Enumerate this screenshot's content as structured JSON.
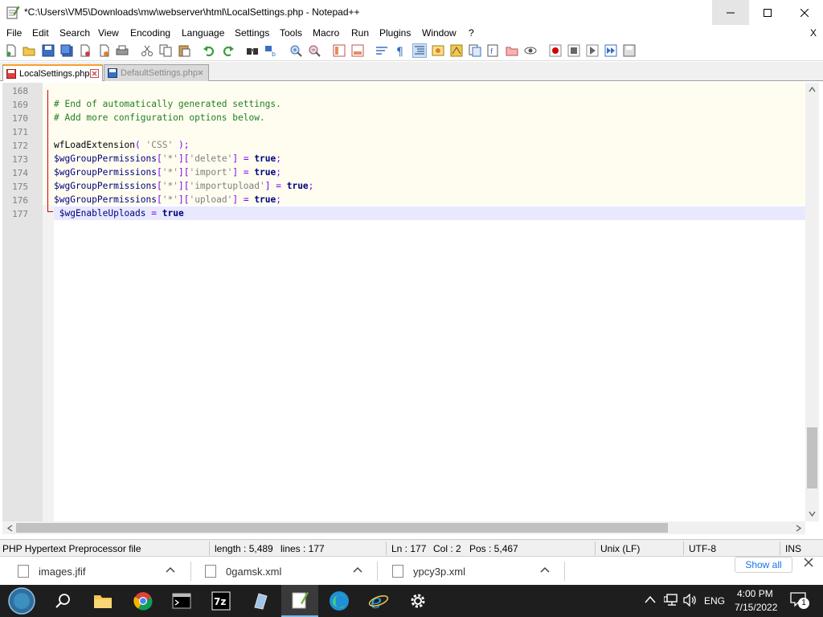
{
  "window": {
    "title": "*C:\\Users\\VM5\\Downloads\\mw\\webserver\\html\\LocalSettings.php - Notepad++"
  },
  "menu": [
    "File",
    "Edit",
    "Search",
    "View",
    "Encoding",
    "Language",
    "Settings",
    "Tools",
    "Macro",
    "Run",
    "Plugins",
    "Window",
    "?"
  ],
  "menu_close": "X",
  "tabs": [
    {
      "label": "LocalSettings.php",
      "active": true
    },
    {
      "label": "DefaultSettings.php",
      "active": false
    }
  ],
  "lines": [
    {
      "num": "168"
    },
    {
      "num": "169"
    },
    {
      "num": "170"
    },
    {
      "num": "171"
    },
    {
      "num": "172"
    },
    {
      "num": "173"
    },
    {
      "num": "174"
    },
    {
      "num": "175"
    },
    {
      "num": "176"
    },
    {
      "num": "177"
    }
  ],
  "code": {
    "l169": "# End of automatically generated settings.",
    "l170": "# Add more configuration options below.",
    "l172_fn": "wfLoadExtension",
    "l172_open": "( ",
    "l172_str": "'CSS'",
    "l172_close": " );",
    "var_perm": "$wgGroupPermissions",
    "bracket_open": "[",
    "bracket_close": "]",
    "star": "'*'",
    "delete": "'delete'",
    "import": "'import'",
    "importupload": "'importupload'",
    "upload": "'upload'",
    "eq": " = ",
    "true": "true",
    "semi": ";",
    "l177_var": " $wgEnableUploads",
    "l177_eq": " = ",
    "l177_val": "true"
  },
  "status": {
    "filetype": "PHP Hypertext Preprocessor file",
    "length": "length : 5,489",
    "lines": "lines : 177",
    "ln": "Ln : 177",
    "col": "Col : 2",
    "pos": "Pos : 5,467",
    "eol": "Unix (LF)",
    "encoding": "UTF-8",
    "mode": "INS"
  },
  "downloads": {
    "items": [
      "images.jfif",
      "0gamsk.xml",
      "ypcy3p.xml"
    ],
    "show_all": "Show all"
  },
  "taskbar": {
    "lang": "ENG",
    "time": "4:00 PM",
    "date": "7/15/2022",
    "notif": "1"
  },
  "colors": {
    "comment": "#238023",
    "keyword": "#000080",
    "string": "#808080",
    "fold": "#d00000",
    "current_line": "#e8e8ff"
  }
}
